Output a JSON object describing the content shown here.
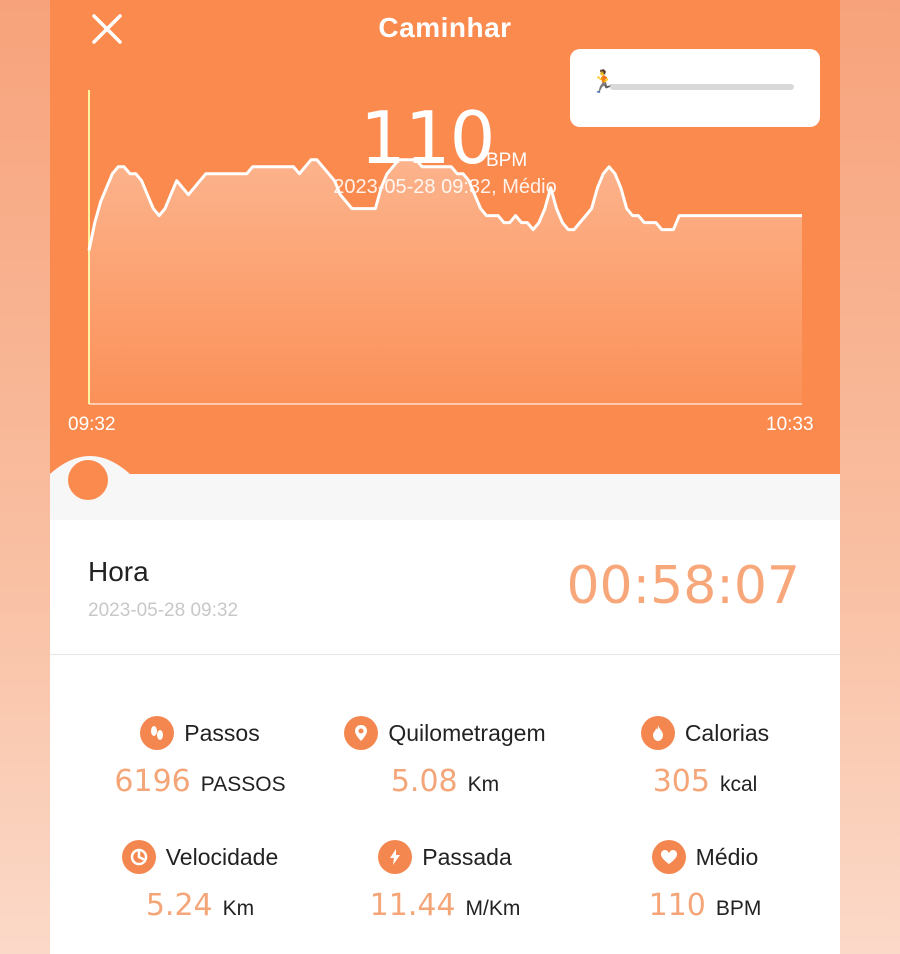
{
  "header": {
    "title": "Caminhar"
  },
  "heart_rate": {
    "value": "110",
    "unit": "BPM",
    "subtitle": "2023-05-28 09:32, Médio"
  },
  "chart_data": {
    "type": "area",
    "x_start_label": "09:32",
    "x_end_label": "10:33",
    "x": [
      0,
      0.5,
      1,
      1.5,
      2,
      2.5,
      3,
      3.5,
      4,
      4.5,
      5,
      5.5,
      6,
      6.5,
      7,
      7.5,
      8,
      8.5,
      9,
      9.5,
      10,
      10.5,
      11,
      11.5,
      12,
      12.5,
      13,
      13.5,
      14,
      14.5,
      15,
      15.5,
      16,
      16.5,
      17,
      17.5,
      18,
      18.5,
      19,
      19.5,
      20,
      20.5,
      21,
      21.5,
      22,
      22.5,
      23,
      23.5,
      24,
      24.5,
      25,
      25.5,
      26,
      26.5,
      27,
      27.5,
      28,
      28.5,
      29,
      29.5,
      30,
      30.5,
      31,
      31.5,
      32,
      32.5,
      33,
      33.5,
      34,
      34.5,
      35,
      35.5,
      36,
      36.5,
      37,
      37.5,
      38,
      38.5,
      39,
      39.5,
      40,
      40.5,
      41,
      41.5,
      42,
      42.5,
      43,
      43.5,
      44,
      44.5,
      45,
      45.5,
      46,
      46.5,
      47,
      47.5,
      48,
      48.5,
      49,
      49.5,
      50,
      50.5,
      51,
      51.5,
      52,
      52.5,
      53,
      53.5,
      54,
      54.5,
      55,
      55.5,
      56,
      56.5,
      57,
      57.5,
      58,
      58.5,
      59,
      59.5,
      60,
      61
    ],
    "y": [
      92,
      96,
      99,
      101,
      103,
      104,
      104,
      103,
      103,
      102,
      100,
      98,
      97,
      98,
      100,
      102,
      101,
      100,
      101,
      102,
      103,
      103,
      103,
      103,
      103,
      103,
      103,
      103,
      104,
      104,
      104,
      104,
      104,
      104,
      104,
      104,
      103,
      104,
      105,
      105,
      104,
      103,
      102,
      100,
      99,
      98,
      98,
      98,
      98,
      98,
      101,
      103,
      104,
      105,
      105,
      105,
      105,
      104,
      104,
      104,
      104,
      104,
      104,
      103,
      103,
      102,
      100,
      98,
      97,
      97,
      97,
      96,
      96,
      97,
      96,
      96,
      95,
      96,
      98,
      101,
      98,
      96,
      95,
      95,
      96,
      97,
      98,
      101,
      103,
      104,
      103,
      101,
      98,
      97,
      97,
      96,
      96,
      96,
      95,
      95,
      95,
      97,
      97,
      97,
      97,
      97,
      97,
      97,
      97,
      97,
      97,
      97,
      97,
      97,
      97,
      97,
      97,
      97,
      97,
      97,
      97,
      97
    ],
    "ylim": [
      70,
      115
    ]
  },
  "summary": {
    "label": "Hora",
    "date": "2023-05-28 09:32",
    "duration": "00:58:07"
  },
  "stats": [
    {
      "icon": "footprints-icon",
      "label": "Passos",
      "value": "6196",
      "unit": "PASSOS"
    },
    {
      "icon": "location-pin-icon",
      "label": "Quilometragem",
      "value": "5.08",
      "unit": "Km"
    },
    {
      "icon": "flame-icon",
      "label": "Calorias",
      "value": "305",
      "unit": "kcal"
    },
    {
      "icon": "clock-icon",
      "label": "Velocidade",
      "value": "5.24",
      "unit": "Km"
    },
    {
      "icon": "lightning-icon",
      "label": "Passada",
      "value": "11.44",
      "unit": "M/Km"
    },
    {
      "icon": "heart-icon",
      "label": "Médio",
      "value": "110",
      "unit": "BPM"
    }
  ],
  "colors": {
    "accent": "#fb8a4e",
    "value": "#f4a679"
  }
}
